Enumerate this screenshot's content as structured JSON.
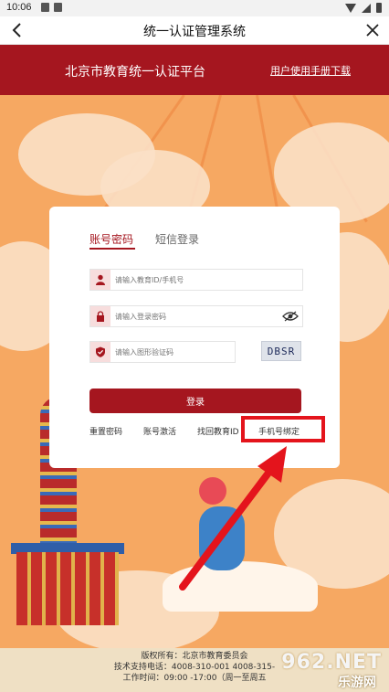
{
  "status_bar": {
    "time": "10:06"
  },
  "nav": {
    "title": "统一认证管理系统"
  },
  "header": {
    "platform_name": "北京市教育统一认证平台",
    "manual_link": "用户使用手册下载"
  },
  "login": {
    "tabs": [
      {
        "label": "账号密码",
        "active": true
      },
      {
        "label": "短信登录",
        "active": false
      }
    ],
    "fields": {
      "account_placeholder": "请输入教育ID/手机号",
      "password_placeholder": "请输入登录密码",
      "captcha_placeholder": "请输入图形验证码",
      "captcha_text": "DBSR"
    },
    "login_button": "登录",
    "links": [
      "重置密码",
      "账号激活",
      "找回教育ID",
      "手机号绑定"
    ]
  },
  "footer": {
    "copyright": "版权所有：北京市教育委员会",
    "support": "技术支持电话：4008-310-001 4008-315-",
    "hours": "工作时间：09:00 -17:00（周一至周五"
  },
  "watermark": {
    "line1": "962.NET",
    "line2": "乐游网"
  },
  "colors": {
    "brand_red": "#a5161f",
    "highlight_red": "#e4141c",
    "background_orange": "#f6a862"
  }
}
